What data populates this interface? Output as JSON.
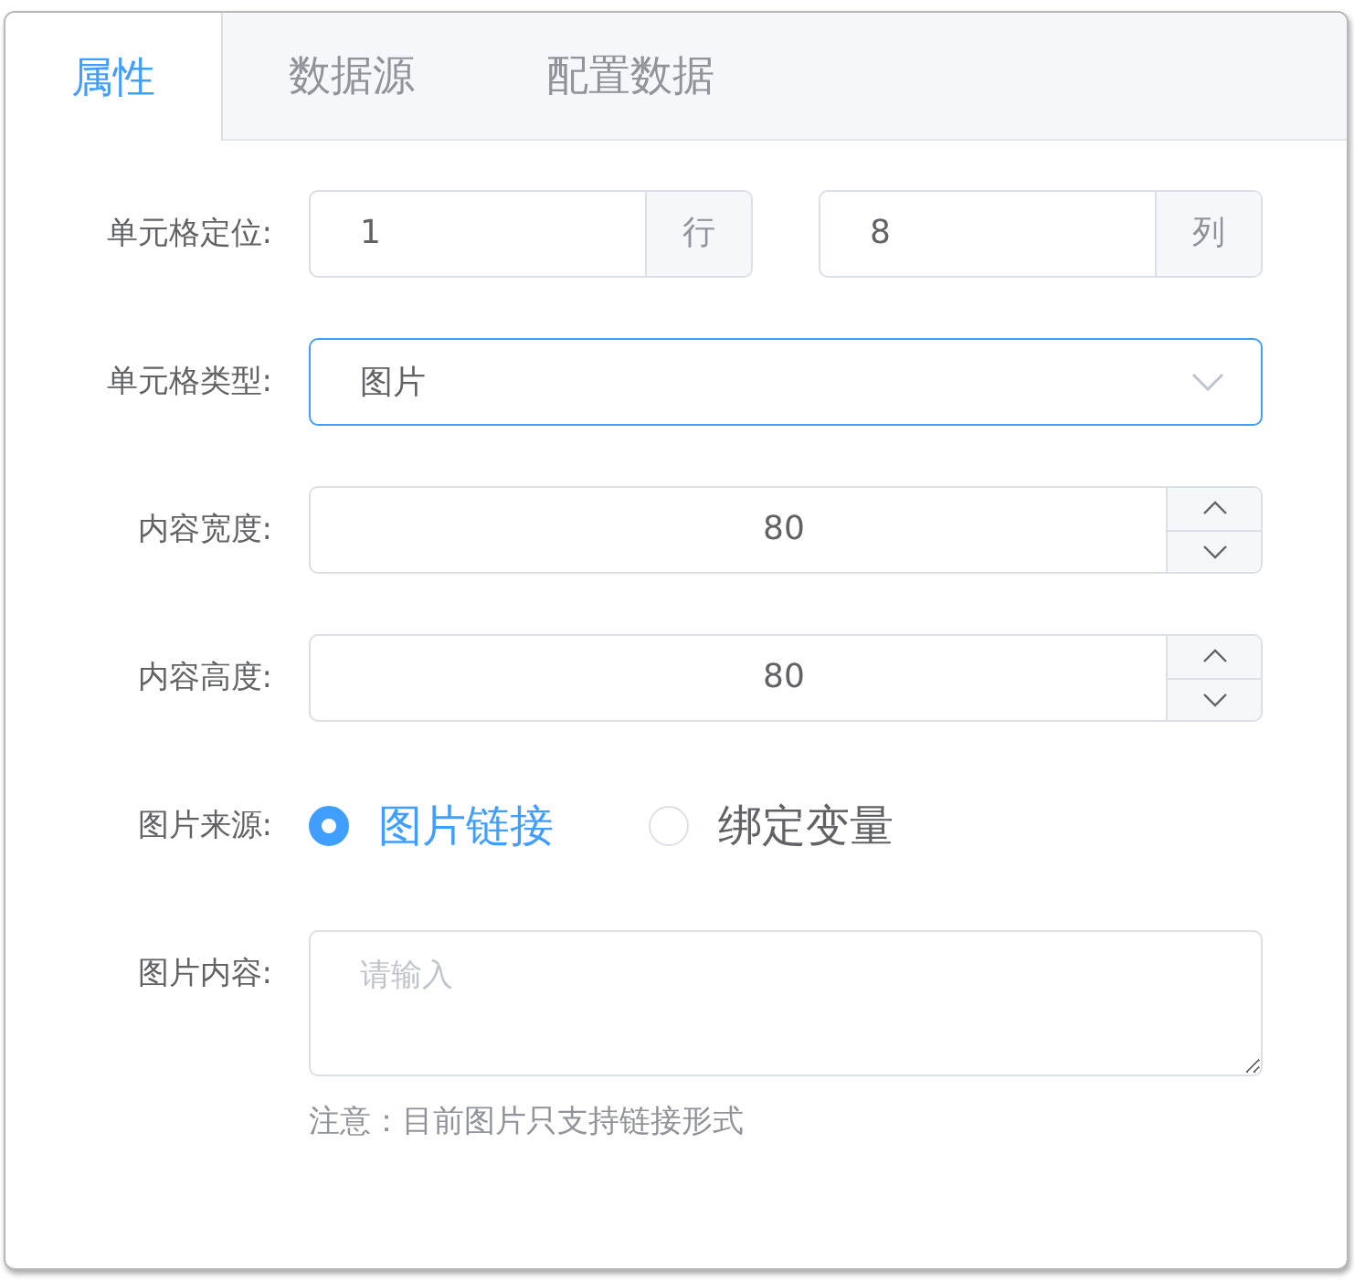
{
  "tabs": [
    {
      "label": "属性",
      "selected": true
    },
    {
      "label": "数据源",
      "selected": false
    },
    {
      "label": "配置数据",
      "selected": false
    }
  ],
  "form": [
    {
      "kind": "position",
      "label": "单元格定位:",
      "row": {
        "value": "1",
        "unit": "行"
      },
      "column": {
        "value": "8",
        "unit": "列"
      }
    },
    {
      "kind": "select",
      "label": "单元格类型:",
      "value": "图片",
      "focused": true
    },
    {
      "kind": "number",
      "label": "内容宽度:",
      "value": "80"
    },
    {
      "kind": "number",
      "label": "内容高度:",
      "value": "80"
    },
    {
      "kind": "radio",
      "label": "图片来源:",
      "options": [
        {
          "label": "图片链接",
          "selected": true
        },
        {
          "label": "绑定变量",
          "selected": false
        }
      ]
    },
    {
      "kind": "textarea",
      "label": "图片内容:",
      "placeholder": "请输入",
      "note": "注意：目前图片只支持链接形式"
    }
  ]
}
